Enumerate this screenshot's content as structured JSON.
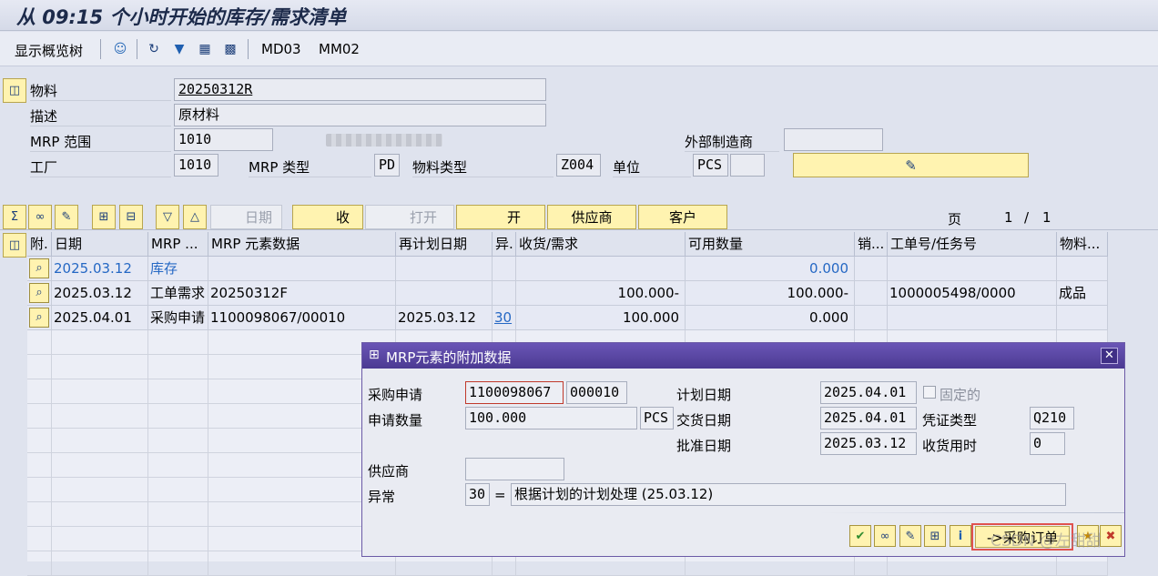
{
  "title": "从 09:15 个小时开始的库存/需求清单",
  "toolbar": {
    "tree_label": "显示概览树",
    "md03": "MD03",
    "mm02": "MM02"
  },
  "header": {
    "material_label": "物料",
    "material_value": "20250312R",
    "desc_label": "描述",
    "desc_value": "原材料",
    "mrp_area_label": "MRP 范围",
    "mrp_area_value": "1010",
    "ext_mfr_label": "外部制造商",
    "ext_mfr_value": "",
    "plant_label": "工厂",
    "plant_value": "1010",
    "mrp_type_label": "MRP 类型",
    "mrp_type_value": "PD",
    "mat_type_label": "物料类型",
    "mat_type_value": "Z004",
    "unit_label": "单位",
    "unit_value": "PCS"
  },
  "buttons": {
    "date": "日期",
    "receipt": "收",
    "open1": "打开",
    "open2": "开",
    "vendor": "供应商",
    "customer": "客户",
    "page_label": "页",
    "page_current": "1",
    "page_sep": "/",
    "page_total": "1"
  },
  "grid": {
    "headers": [
      "附.",
      "日期",
      "MRP ...",
      "MRP 元素数据",
      "再计划日期",
      "异.",
      "收货/需求",
      "可用数量",
      "销...",
      "工单号/任务号",
      "物料..."
    ],
    "rows": [
      {
        "date": "2025.03.12",
        "mrp": "库存",
        "data": "",
        "resched": "",
        "exc": "",
        "recv": "",
        "avail": "0.000",
        "sales": "",
        "order": "",
        "mat": "",
        "blue": true
      },
      {
        "date": "2025.03.12",
        "mrp": "工单需求",
        "data": "20250312F",
        "resched": "",
        "exc": "",
        "recv": "100.000-",
        "avail": "100.000-",
        "sales": "",
        "order": "1000005498/0000",
        "mat": "成品",
        "blue": false
      },
      {
        "date": "2025.04.01",
        "mrp": "采购申请",
        "data": "1100098067/00010",
        "resched": "2025.03.12",
        "exc": "30",
        "recv": "100.000",
        "avail": "0.000",
        "sales": "",
        "order": "",
        "mat": "",
        "blue": false
      }
    ]
  },
  "dialog": {
    "title": "MRP元素的附加数据",
    "pr_label": "采购申请",
    "pr_number": "1100098067",
    "pr_item": "000010",
    "plan_date_label": "计划日期",
    "plan_date": "2025.04.01",
    "fixed_label": "固定的",
    "qty_label": "申请数量",
    "qty": "100.000",
    "qty_unit": "PCS",
    "delivery_label": "交货日期",
    "delivery_date": "2025.04.01",
    "doc_type_label": "凭证类型",
    "doc_type": "Q210",
    "release_label": "批准日期",
    "release_date": "2025.03.12",
    "gr_time_label": "收货用时",
    "gr_time": "0",
    "vendor_label": "供应商",
    "vendor": "",
    "exc_label": "异常",
    "exc_code": "30",
    "exc_eq": "=",
    "exc_text": "根据计划的计划处理 (25.03.12)",
    "po_button": "->采购订单"
  },
  "watermark": "CSDN @左甜甜"
}
